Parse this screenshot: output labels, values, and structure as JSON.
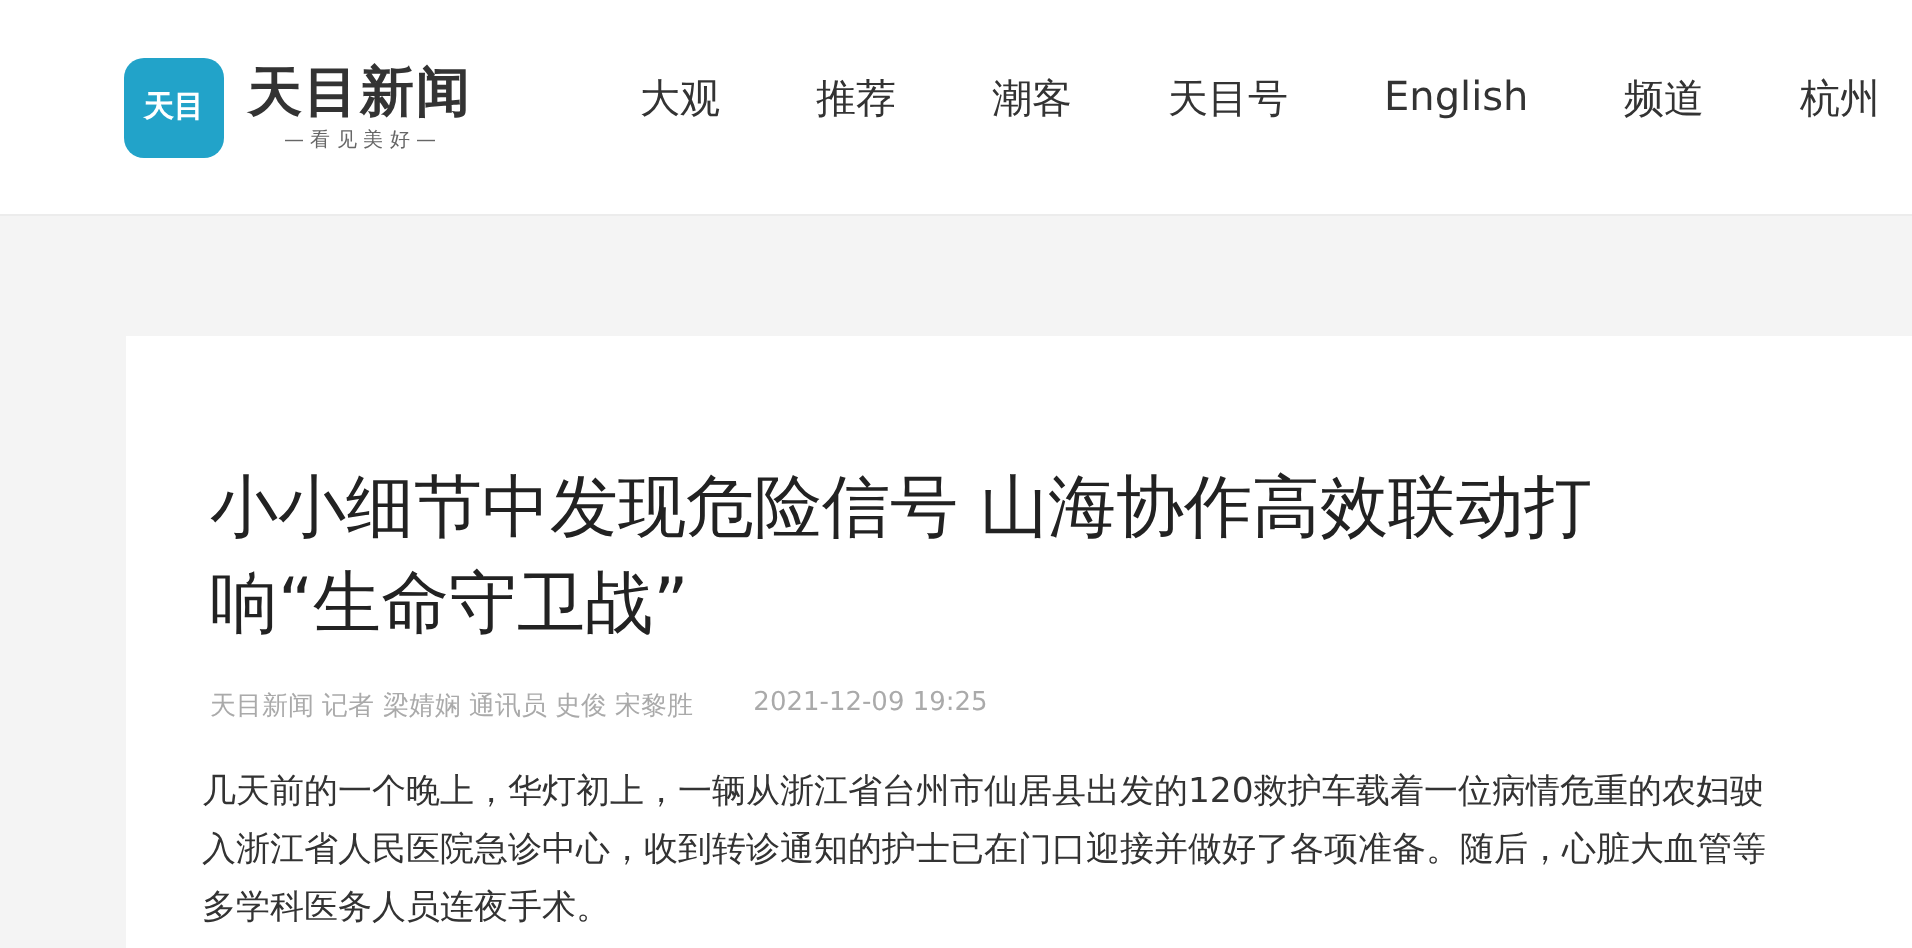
{
  "header": {
    "logo_mark": "天目",
    "site_name": "天目新闻",
    "slogan": "— 看 见 美 好 —",
    "nav": [
      {
        "label": "大观"
      },
      {
        "label": "推荐"
      },
      {
        "label": "潮客"
      },
      {
        "label": "天目号"
      },
      {
        "label": "English"
      },
      {
        "label": "频道"
      },
      {
        "label": "杭州"
      }
    ]
  },
  "article": {
    "title": "小小细节中发现危险信号 山海协作高效联动打响“生命守卫战”",
    "byline": "天目新闻 记者 梁婧娴 通讯员 史俊 宋黎胜",
    "date": "2021-12-09 19:25",
    "body": "几天前的一个晚上，华灯初上，一辆从浙江省台州市仙居县出发的120救护车载着一位病情危重的农妇驶入浙江省人民医院急诊中心，收到转诊通知的护士已在门口迎接并做好了各项准备。随后，心脏大血管等多学科医务人员连夜手术。"
  }
}
